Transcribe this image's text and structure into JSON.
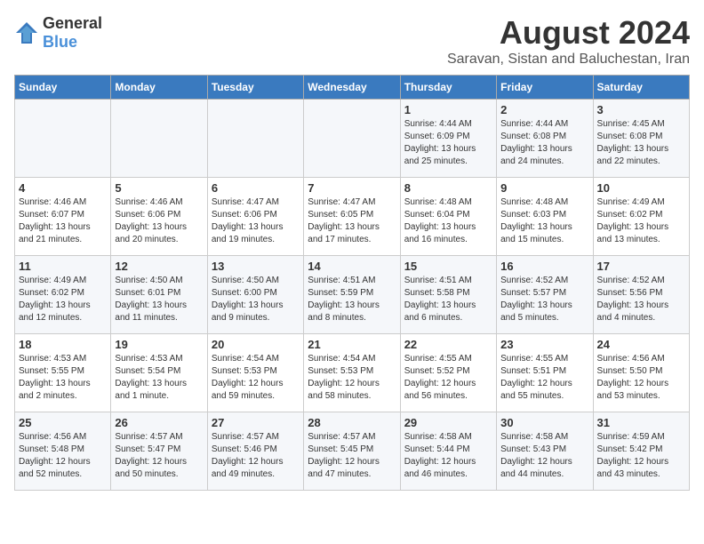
{
  "header": {
    "logo_general": "General",
    "logo_blue": "Blue",
    "main_title": "August 2024",
    "subtitle": "Saravan, Sistan and Baluchestan, Iran"
  },
  "days_of_week": [
    "Sunday",
    "Monday",
    "Tuesday",
    "Wednesday",
    "Thursday",
    "Friday",
    "Saturday"
  ],
  "weeks": [
    [
      {
        "day": "",
        "info": ""
      },
      {
        "day": "",
        "info": ""
      },
      {
        "day": "",
        "info": ""
      },
      {
        "day": "",
        "info": ""
      },
      {
        "day": "1",
        "info": "Sunrise: 4:44 AM\nSunset: 6:09 PM\nDaylight: 13 hours\nand 25 minutes."
      },
      {
        "day": "2",
        "info": "Sunrise: 4:44 AM\nSunset: 6:08 PM\nDaylight: 13 hours\nand 24 minutes."
      },
      {
        "day": "3",
        "info": "Sunrise: 4:45 AM\nSunset: 6:08 PM\nDaylight: 13 hours\nand 22 minutes."
      }
    ],
    [
      {
        "day": "4",
        "info": "Sunrise: 4:46 AM\nSunset: 6:07 PM\nDaylight: 13 hours\nand 21 minutes."
      },
      {
        "day": "5",
        "info": "Sunrise: 4:46 AM\nSunset: 6:06 PM\nDaylight: 13 hours\nand 20 minutes."
      },
      {
        "day": "6",
        "info": "Sunrise: 4:47 AM\nSunset: 6:06 PM\nDaylight: 13 hours\nand 19 minutes."
      },
      {
        "day": "7",
        "info": "Sunrise: 4:47 AM\nSunset: 6:05 PM\nDaylight: 13 hours\nand 17 minutes."
      },
      {
        "day": "8",
        "info": "Sunrise: 4:48 AM\nSunset: 6:04 PM\nDaylight: 13 hours\nand 16 minutes."
      },
      {
        "day": "9",
        "info": "Sunrise: 4:48 AM\nSunset: 6:03 PM\nDaylight: 13 hours\nand 15 minutes."
      },
      {
        "day": "10",
        "info": "Sunrise: 4:49 AM\nSunset: 6:02 PM\nDaylight: 13 hours\nand 13 minutes."
      }
    ],
    [
      {
        "day": "11",
        "info": "Sunrise: 4:49 AM\nSunset: 6:02 PM\nDaylight: 13 hours\nand 12 minutes."
      },
      {
        "day": "12",
        "info": "Sunrise: 4:50 AM\nSunset: 6:01 PM\nDaylight: 13 hours\nand 11 minutes."
      },
      {
        "day": "13",
        "info": "Sunrise: 4:50 AM\nSunset: 6:00 PM\nDaylight: 13 hours\nand 9 minutes."
      },
      {
        "day": "14",
        "info": "Sunrise: 4:51 AM\nSunset: 5:59 PM\nDaylight: 13 hours\nand 8 minutes."
      },
      {
        "day": "15",
        "info": "Sunrise: 4:51 AM\nSunset: 5:58 PM\nDaylight: 13 hours\nand 6 minutes."
      },
      {
        "day": "16",
        "info": "Sunrise: 4:52 AM\nSunset: 5:57 PM\nDaylight: 13 hours\nand 5 minutes."
      },
      {
        "day": "17",
        "info": "Sunrise: 4:52 AM\nSunset: 5:56 PM\nDaylight: 13 hours\nand 4 minutes."
      }
    ],
    [
      {
        "day": "18",
        "info": "Sunrise: 4:53 AM\nSunset: 5:55 PM\nDaylight: 13 hours\nand 2 minutes."
      },
      {
        "day": "19",
        "info": "Sunrise: 4:53 AM\nSunset: 5:54 PM\nDaylight: 13 hours\nand 1 minute."
      },
      {
        "day": "20",
        "info": "Sunrise: 4:54 AM\nSunset: 5:53 PM\nDaylight: 12 hours\nand 59 minutes."
      },
      {
        "day": "21",
        "info": "Sunrise: 4:54 AM\nSunset: 5:53 PM\nDaylight: 12 hours\nand 58 minutes."
      },
      {
        "day": "22",
        "info": "Sunrise: 4:55 AM\nSunset: 5:52 PM\nDaylight: 12 hours\nand 56 minutes."
      },
      {
        "day": "23",
        "info": "Sunrise: 4:55 AM\nSunset: 5:51 PM\nDaylight: 12 hours\nand 55 minutes."
      },
      {
        "day": "24",
        "info": "Sunrise: 4:56 AM\nSunset: 5:50 PM\nDaylight: 12 hours\nand 53 minutes."
      }
    ],
    [
      {
        "day": "25",
        "info": "Sunrise: 4:56 AM\nSunset: 5:48 PM\nDaylight: 12 hours\nand 52 minutes."
      },
      {
        "day": "26",
        "info": "Sunrise: 4:57 AM\nSunset: 5:47 PM\nDaylight: 12 hours\nand 50 minutes."
      },
      {
        "day": "27",
        "info": "Sunrise: 4:57 AM\nSunset: 5:46 PM\nDaylight: 12 hours\nand 49 minutes."
      },
      {
        "day": "28",
        "info": "Sunrise: 4:57 AM\nSunset: 5:45 PM\nDaylight: 12 hours\nand 47 minutes."
      },
      {
        "day": "29",
        "info": "Sunrise: 4:58 AM\nSunset: 5:44 PM\nDaylight: 12 hours\nand 46 minutes."
      },
      {
        "day": "30",
        "info": "Sunrise: 4:58 AM\nSunset: 5:43 PM\nDaylight: 12 hours\nand 44 minutes."
      },
      {
        "day": "31",
        "info": "Sunrise: 4:59 AM\nSunset: 5:42 PM\nDaylight: 12 hours\nand 43 minutes."
      }
    ]
  ]
}
